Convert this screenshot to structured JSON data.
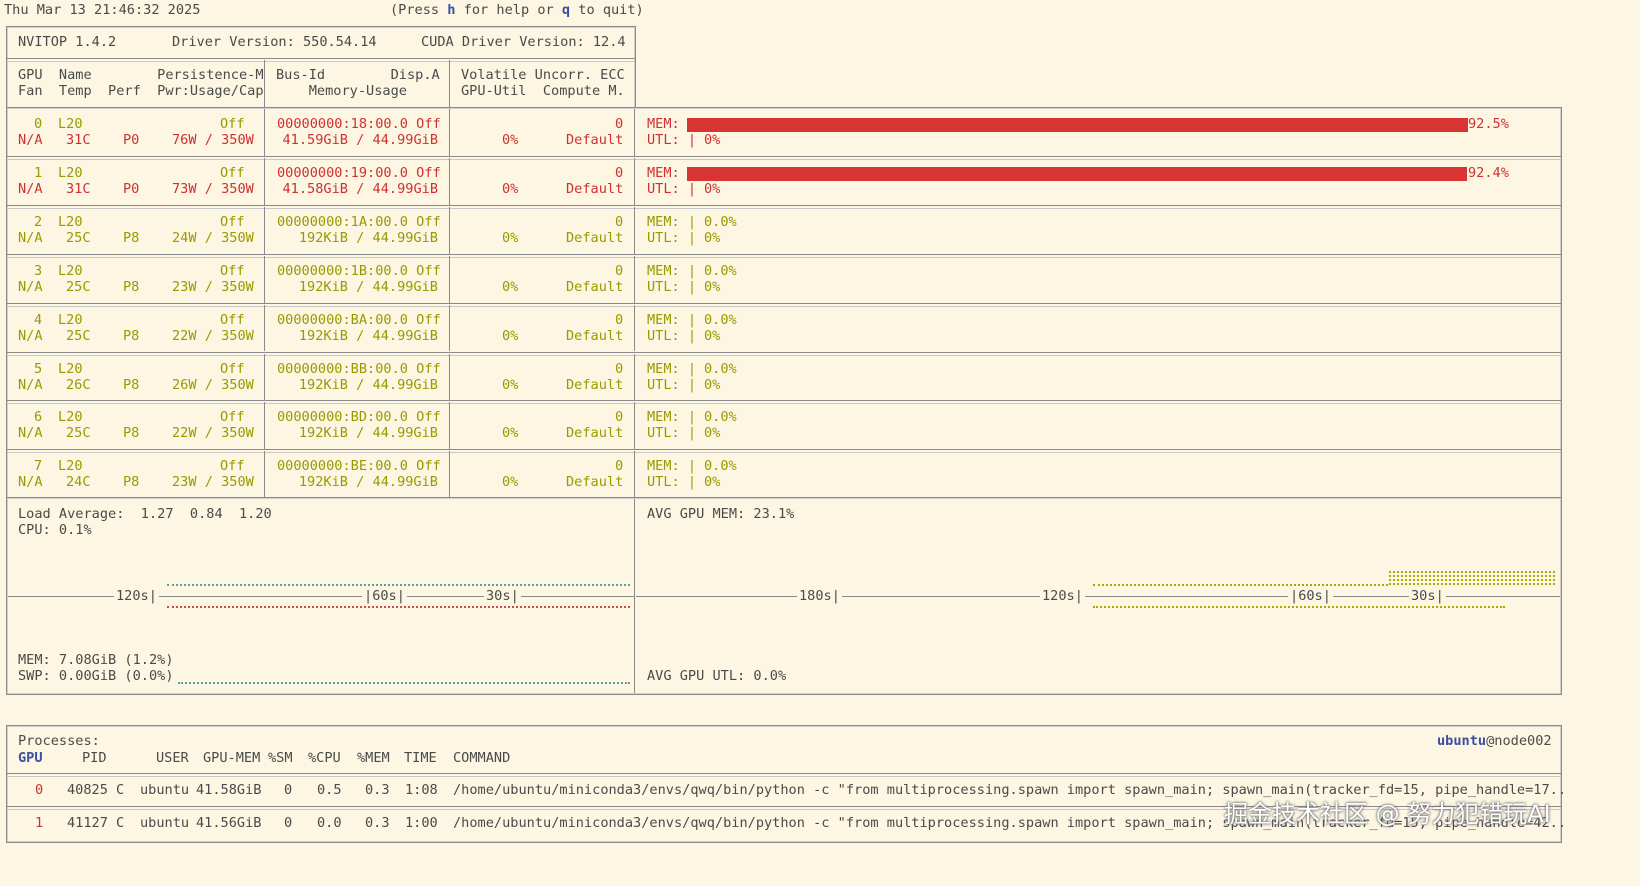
{
  "topbar": {
    "datetime": "Thu Mar 13 21:46:32 2025",
    "help_pre": "(Press ",
    "help_key": "h",
    "help_mid": " for help or ",
    "quit_key": "q",
    "help_post": " to quit)"
  },
  "header": {
    "version": "NVITOP 1.4.2",
    "driver": "Driver Version: 550.54.14",
    "cuda": "CUDA Driver Version: 12.4",
    "col1_row1": "GPU  Name        Persistence-M",
    "col1_row2": "Fan  Temp  Perf  Pwr:Usage/Cap",
    "col2_row1": "Bus-Id        Disp.A",
    "col2_row2": "    Memory-Usage",
    "col3_row1": "Volatile Uncorr. ECC",
    "col3_row2": "GPU-Util  Compute M."
  },
  "gpus": [
    {
      "id": "0",
      "name": "L20",
      "persist": "Off",
      "fan": "N/A",
      "temp": "31C",
      "perf": "P0",
      "power": "76W / 350W",
      "bus": "00000000:18:00.0 Off",
      "mem": "41.59GiB / 44.99GiB",
      "ecc": "0",
      "util": "0%",
      "compute": "Default",
      "mem_label": "MEM:",
      "mem_pct": "92.5%",
      "mem_frac": 0.925,
      "utl_label": "UTL: |",
      "utl_pct": "0%",
      "active": true
    },
    {
      "id": "1",
      "name": "L20",
      "persist": "Off",
      "fan": "N/A",
      "temp": "31C",
      "perf": "P0",
      "power": "73W / 350W",
      "bus": "00000000:19:00.0 Off",
      "mem": "41.58GiB / 44.99GiB",
      "ecc": "0",
      "util": "0%",
      "compute": "Default",
      "mem_label": "MEM:",
      "mem_pct": "92.4%",
      "mem_frac": 0.924,
      "utl_label": "UTL: |",
      "utl_pct": "0%",
      "active": true
    },
    {
      "id": "2",
      "name": "L20",
      "persist": "Off",
      "fan": "N/A",
      "temp": "25C",
      "perf": "P8",
      "power": "24W / 350W",
      "bus": "00000000:1A:00.0 Off",
      "mem": "192KiB / 44.99GiB",
      "ecc": "0",
      "util": "0%",
      "compute": "Default",
      "mem_label": "MEM: |",
      "mem_pct": "0.0%",
      "mem_frac": 0,
      "utl_label": "UTL: |",
      "utl_pct": "0%",
      "active": false
    },
    {
      "id": "3",
      "name": "L20",
      "persist": "Off",
      "fan": "N/A",
      "temp": "25C",
      "perf": "P8",
      "power": "23W / 350W",
      "bus": "00000000:1B:00.0 Off",
      "mem": "192KiB / 44.99GiB",
      "ecc": "0",
      "util": "0%",
      "compute": "Default",
      "mem_label": "MEM: |",
      "mem_pct": "0.0%",
      "mem_frac": 0,
      "utl_label": "UTL: |",
      "utl_pct": "0%",
      "active": false
    },
    {
      "id": "4",
      "name": "L20",
      "persist": "Off",
      "fan": "N/A",
      "temp": "25C",
      "perf": "P8",
      "power": "22W / 350W",
      "bus": "00000000:BA:00.0 Off",
      "mem": "192KiB / 44.99GiB",
      "ecc": "0",
      "util": "0%",
      "compute": "Default",
      "mem_label": "MEM: |",
      "mem_pct": "0.0%",
      "mem_frac": 0,
      "utl_label": "UTL: |",
      "utl_pct": "0%",
      "active": false
    },
    {
      "id": "5",
      "name": "L20",
      "persist": "Off",
      "fan": "N/A",
      "temp": "26C",
      "perf": "P8",
      "power": "26W / 350W",
      "bus": "00000000:BB:00.0 Off",
      "mem": "192KiB / 44.99GiB",
      "ecc": "0",
      "util": "0%",
      "compute": "Default",
      "mem_label": "MEM: |",
      "mem_pct": "0.0%",
      "mem_frac": 0,
      "utl_label": "UTL: |",
      "utl_pct": "0%",
      "active": false
    },
    {
      "id": "6",
      "name": "L20",
      "persist": "Off",
      "fan": "N/A",
      "temp": "25C",
      "perf": "P8",
      "power": "22W / 350W",
      "bus": "00000000:BD:00.0 Off",
      "mem": "192KiB / 44.99GiB",
      "ecc": "0",
      "util": "0%",
      "compute": "Default",
      "mem_label": "MEM: |",
      "mem_pct": "0.0%",
      "mem_frac": 0,
      "utl_label": "UTL: |",
      "utl_pct": "0%",
      "active": false
    },
    {
      "id": "7",
      "name": "L20",
      "persist": "Off",
      "fan": "N/A",
      "temp": "24C",
      "perf": "P8",
      "power": "23W / 350W",
      "bus": "00000000:BE:00.0 Off",
      "mem": "192KiB / 44.99GiB",
      "ecc": "0",
      "util": "0%",
      "compute": "Default",
      "mem_label": "MEM: |",
      "mem_pct": "0.0%",
      "mem_frac": 0,
      "utl_label": "UTL: |",
      "utl_pct": "0%",
      "active": false
    }
  ],
  "host": {
    "load_label": "Load Average:",
    "load_values": "1.27  0.84  1.20",
    "cpu": "CPU: 0.1%",
    "mem": "MEM: 7.08GiB (1.2%)",
    "swp": "SWP: 0.00GiB (0.0%)",
    "ticks": [
      "120s",
      "60s",
      "30s"
    ]
  },
  "gpu_history": {
    "avg_mem": "AVG GPU MEM: 23.1%",
    "avg_utl": "AVG GPU UTL: 0.0%",
    "ticks": [
      "180s",
      "120s",
      "60s",
      "30s"
    ]
  },
  "processes": {
    "title": "Processes:",
    "user_host": "ubuntu",
    "host_suffix": "@node002",
    "headers": [
      "GPU",
      "PID",
      "USER",
      "GPU-MEM",
      "%SM",
      "%CPU",
      "%MEM",
      "TIME",
      "COMMAND"
    ],
    "rows": [
      {
        "gpu": "0",
        "pid": "40825",
        "type": "C",
        "user": "ubuntu",
        "gpumem": "41.58GiB",
        "sm": "0",
        "cpu": "0.5",
        "mem": "0.3",
        "time": "1:08",
        "command": "/home/ubuntu/miniconda3/envs/qwq/bin/python -c \"from multiprocessing.spawn import spawn_main; spawn_main(tracker_fd=15, pipe_handle=17.."
      },
      {
        "gpu": "1",
        "pid": "41127",
        "type": "C",
        "user": "ubuntu",
        "gpumem": "41.56GiB",
        "sm": "0",
        "cpu": "0.0",
        "mem": "0.3",
        "time": "1:00",
        "command": "/home/ubuntu/miniconda3/envs/qwq/bin/python -c \"from multiprocessing.spawn import spawn_main; spawn_main(tracker_fd=15, pipe_handle=42.."
      }
    ]
  },
  "watermark": "掘金技术社区 @ 努力犯错玩AI",
  "colors": {
    "background": "#fdf6e3",
    "yellow": "#9a9a00",
    "red": "#d03030",
    "bar": "#d93434",
    "accent": "#3a4fa0"
  }
}
